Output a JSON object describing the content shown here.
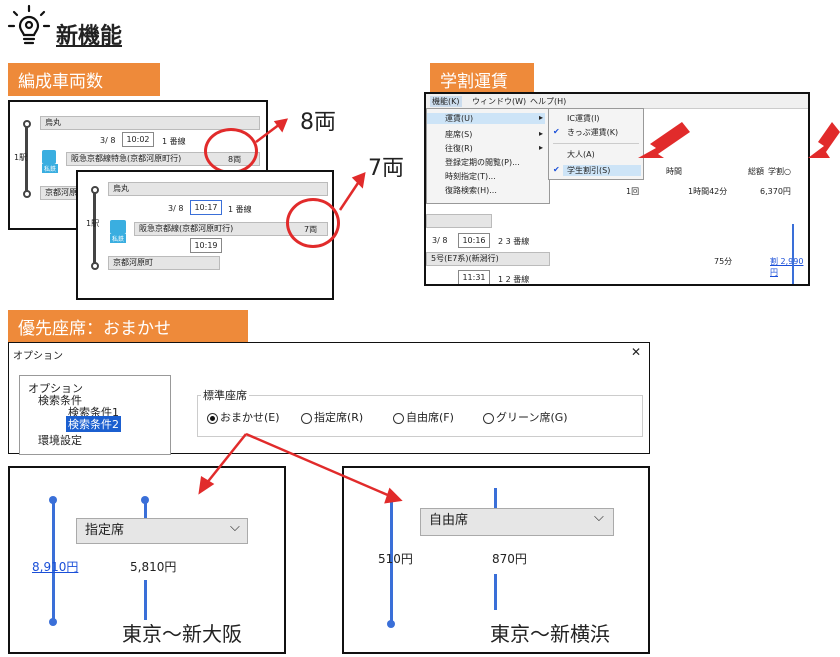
{
  "header": {
    "title": "新機能",
    "icon": "lightbulb-gear-icon"
  },
  "section1": {
    "tag": "編成車両数",
    "back": {
      "station_from": "烏丸",
      "date": "3/ 8",
      "time": "10:02",
      "platform": "1 番線",
      "track_label": "1駅",
      "train": "阪急京都線特急(京都河原町行)",
      "cars": "8両",
      "station_to": "京都河原町",
      "icon_label": "私鉄"
    },
    "front": {
      "station_from": "烏丸",
      "date": "3/ 8",
      "time": "10:17",
      "platform": "1 番線",
      "track_label": "1駅",
      "train": "阪急京都線(京都河原町行)",
      "cars": "7両",
      "arrive_time": "10:19",
      "station_to": "京都河原町",
      "icon_label": "私鉄"
    },
    "callout_back": "8両",
    "callout_front": "7両"
  },
  "section2": {
    "tag": "学割運賃",
    "menubar": [
      "機能(K)",
      "ウィンドウ(W)",
      "ヘルプ(H)"
    ],
    "menu1": [
      "運賃(U)",
      "座席(S)",
      "往復(R)",
      "登録定期の閲覧(P)...",
      "時刻指定(T)...",
      "復路検索(H)..."
    ],
    "menu2": [
      "IC運賃(I)",
      "きっぷ運賃(K)",
      "大人(A)",
      "学生割引(S)"
    ],
    "table_headers": [
      "時間",
      "総額",
      "学割○"
    ],
    "table_row": {
      "transfers": "1回",
      "duration": "1時間42分",
      "total": "6,370円"
    },
    "row2": {
      "date": "3/ 8",
      "time": "10:16",
      "platform": "2 3 番線"
    },
    "row3": {
      "train": "5号(E7系)(新潟行)",
      "minutes": "75分",
      "fare": "割 2,990円"
    },
    "row4": {
      "time": "11:31",
      "platform": "1 2 番線"
    }
  },
  "section3": {
    "tag": "優先座席：おまかせ",
    "dialog_title": "オプション",
    "close": "✕",
    "tree": {
      "root": "オプション",
      "node": "検索条件",
      "child1": "検索条件1",
      "child2": "検索条件2",
      "other": "環境設定"
    },
    "group_label": "標準座席",
    "radios": [
      "おまかせ(E)",
      "指定席(R)",
      "自由席(F)",
      "グリーン席(G)"
    ],
    "left_panel": {
      "select": "指定席",
      "fare_link": "8,910円",
      "fare": "5,810円",
      "route": "東京～新大阪"
    },
    "right_panel": {
      "select": "自由席",
      "fare1": "510円",
      "fare2": "870円",
      "route": "東京～新横浜"
    }
  },
  "colors": {
    "accent": "#ee8a3a",
    "highlight": "#e12b2b",
    "line": "#3a6fd8"
  }
}
